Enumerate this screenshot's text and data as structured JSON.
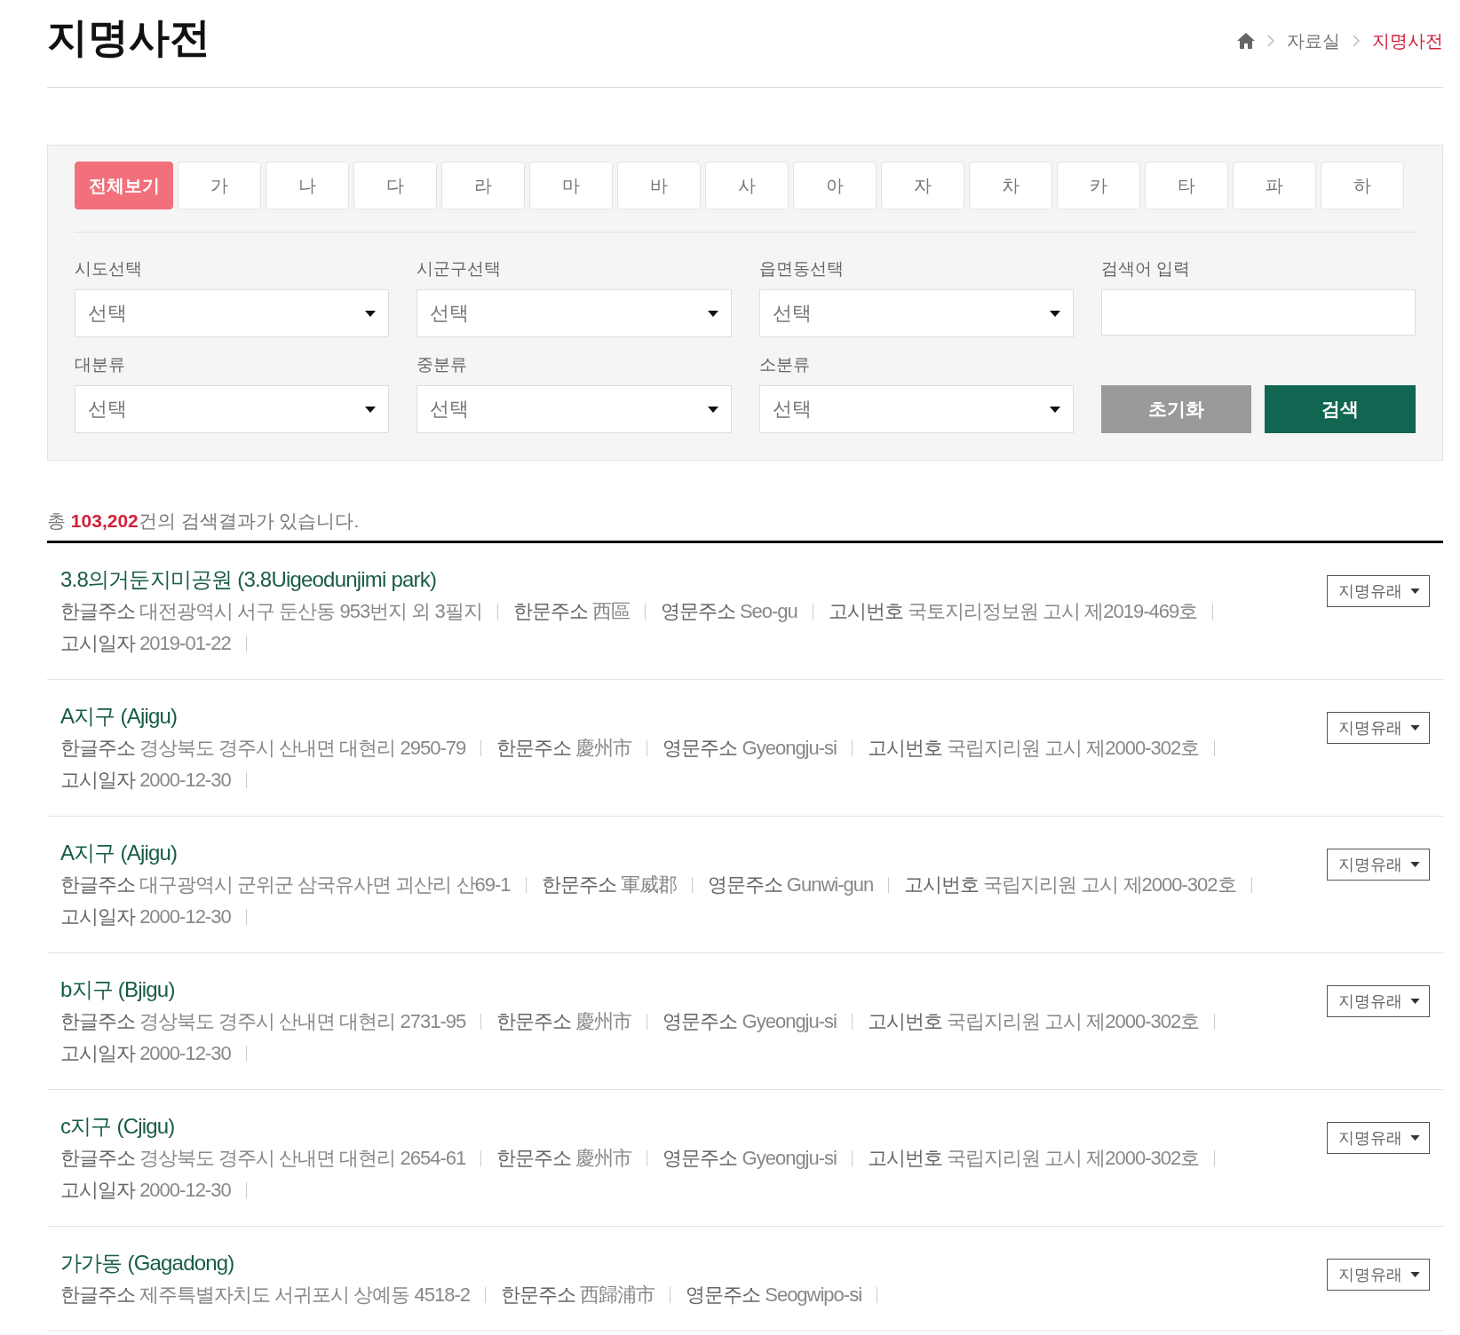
{
  "page_title": "지명사전",
  "breadcrumb": [
    {
      "label": "자료실",
      "current": false
    },
    {
      "label": "지명사전",
      "current": true
    }
  ],
  "index_tabs": [
    {
      "label": "전체보기",
      "selected": true
    },
    {
      "label": "가",
      "selected": false
    },
    {
      "label": "나",
      "selected": false
    },
    {
      "label": "다",
      "selected": false
    },
    {
      "label": "라",
      "selected": false
    },
    {
      "label": "마",
      "selected": false
    },
    {
      "label": "바",
      "selected": false
    },
    {
      "label": "사",
      "selected": false
    },
    {
      "label": "아",
      "selected": false
    },
    {
      "label": "자",
      "selected": false
    },
    {
      "label": "차",
      "selected": false
    },
    {
      "label": "카",
      "selected": false
    },
    {
      "label": "타",
      "selected": false
    },
    {
      "label": "파",
      "selected": false
    },
    {
      "label": "하",
      "selected": false
    }
  ],
  "filters": [
    {
      "label": "시도선택",
      "kind": "select",
      "value": "선택"
    },
    {
      "label": "시군구선택",
      "kind": "select",
      "value": "선택"
    },
    {
      "label": "읍면동선택",
      "kind": "select",
      "value": "선택"
    },
    {
      "label": "검색어 입력",
      "kind": "text"
    },
    {
      "label": "대분류",
      "kind": "select",
      "value": "선택"
    },
    {
      "label": "중분류",
      "kind": "select",
      "value": "선택"
    },
    {
      "label": "소분류",
      "kind": "select",
      "value": "선택"
    }
  ],
  "buttons": [
    {
      "label": "초기화",
      "kind": "reset"
    },
    {
      "label": "검색",
      "kind": "search"
    }
  ],
  "summary": {
    "prefix": "총",
    "count": "103,202",
    "suffix": "건의 검색결과가 있습니다."
  },
  "results": [
    {
      "title": "3.8의거둔지미공원 (3.8Uigeodunjimi park)",
      "button": "지명유래",
      "fields": [
        {
          "label": "한글주소",
          "value": "대전광역시 서구 둔산동 953번지 외 3필지"
        },
        {
          "label": "한문주소",
          "value": "西區"
        },
        {
          "label": "영문주소",
          "value": "Seo-gu"
        },
        {
          "label": "고시번호",
          "value": "국토지리정보원 고시 제2019-469호"
        },
        {
          "label": "고시일자",
          "value": "2019-01-22"
        }
      ]
    },
    {
      "title": "A지구 (Ajigu)",
      "button": "지명유래",
      "fields": [
        {
          "label": "한글주소",
          "value": "경상북도 경주시 산내면 대현리 2950-79"
        },
        {
          "label": "한문주소",
          "value": "慶州市"
        },
        {
          "label": "영문주소",
          "value": "Gyeongju-si"
        },
        {
          "label": "고시번호",
          "value": "국립지리원 고시 제2000-302호"
        },
        {
          "label": "고시일자",
          "value": "2000-12-30"
        }
      ]
    },
    {
      "title": "A지구 (Ajigu)",
      "button": "지명유래",
      "fields": [
        {
          "label": "한글주소",
          "value": "대구광역시 군위군 삼국유사면 괴산리 산69-1"
        },
        {
          "label": "한문주소",
          "value": "軍威郡"
        },
        {
          "label": "영문주소",
          "value": "Gunwi-gun"
        },
        {
          "label": "고시번호",
          "value": "국립지리원 고시 제2000-302호"
        },
        {
          "label": "고시일자",
          "value": "2000-12-30"
        }
      ]
    },
    {
      "title": "b지구 (Bjigu)",
      "button": "지명유래",
      "fields": [
        {
          "label": "한글주소",
          "value": "경상북도 경주시 산내면 대현리 2731-95"
        },
        {
          "label": "한문주소",
          "value": "慶州市"
        },
        {
          "label": "영문주소",
          "value": "Gyeongju-si"
        },
        {
          "label": "고시번호",
          "value": "국립지리원 고시 제2000-302호"
        },
        {
          "label": "고시일자",
          "value": "2000-12-30"
        }
      ]
    },
    {
      "title": "c지구 (Cjigu)",
      "button": "지명유래",
      "fields": [
        {
          "label": "한글주소",
          "value": "경상북도 경주시 산내면 대현리 2654-61"
        },
        {
          "label": "한문주소",
          "value": "慶州市"
        },
        {
          "label": "영문주소",
          "value": "Gyeongju-si"
        },
        {
          "label": "고시번호",
          "value": "국립지리원 고시 제2000-302호"
        },
        {
          "label": "고시일자",
          "value": "2000-12-30"
        }
      ]
    },
    {
      "title": "가가동 (Gagadong)",
      "button": "지명유래",
      "fields": [
        {
          "label": "한글주소",
          "value": "제주특별자치도 서귀포시 상예동 4518-2"
        },
        {
          "label": "한문주소",
          "value": "西歸浦市"
        },
        {
          "label": "영문주소",
          "value": "Seogwipo-si"
        }
      ]
    }
  ]
}
